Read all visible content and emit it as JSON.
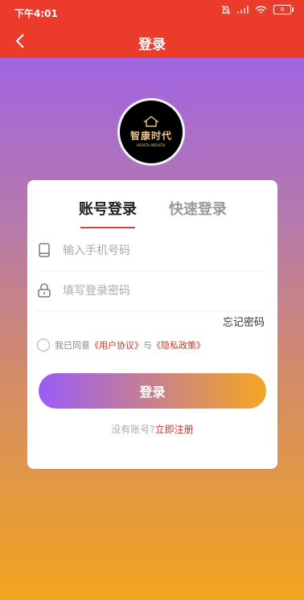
{
  "status": {
    "time": "下午4:01",
    "battery": "8"
  },
  "nav": {
    "title": "登录"
  },
  "logo": {
    "text": "智康时代",
    "sub": "HEALTH WEALTH"
  },
  "tabs": [
    {
      "label": "账号登录",
      "active": true
    },
    {
      "label": "快速登录",
      "active": false
    }
  ],
  "form": {
    "phone_placeholder": "输入手机号码",
    "password_placeholder": "填写登录密码",
    "forgot": "忘记密码"
  },
  "agreement": {
    "prefix": "我已同意",
    "user_agreement": "《用户协议》",
    "and": "与",
    "privacy": "《隐私政策》"
  },
  "login_button": "登录",
  "register": {
    "prefix": "没有账号?",
    "link": "立即注册"
  }
}
